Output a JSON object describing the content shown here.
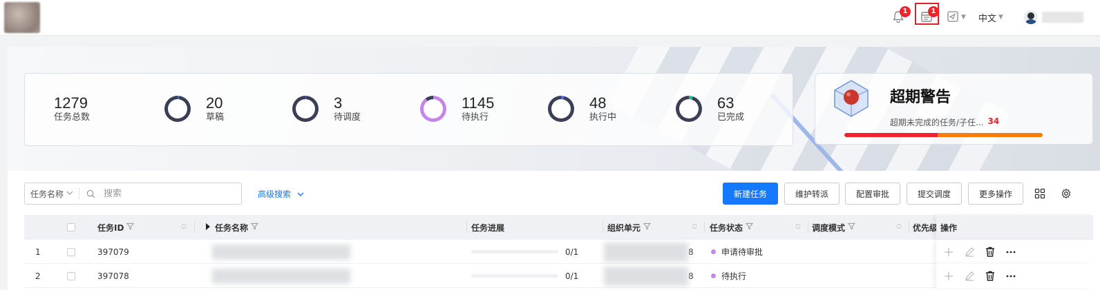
{
  "header": {
    "notification_count": "1",
    "todo_count": "1",
    "language": "中文"
  },
  "stats": [
    {
      "value": "1279",
      "label": "任务总数",
      "ring": false
    },
    {
      "value": "20",
      "label": "草稿",
      "ring": true,
      "fraction": 0.02,
      "color": "#4a6cf7"
    },
    {
      "value": "3",
      "label": "待调度",
      "ring": true,
      "fraction": 0.003,
      "color": "#4a6cf7"
    },
    {
      "value": "1145",
      "label": "待执行",
      "ring": true,
      "fraction": 0.9,
      "color": "#c586e8"
    },
    {
      "value": "48",
      "label": "执行中",
      "ring": true,
      "fraction": 0.04,
      "color": "#4a6cf7"
    },
    {
      "value": "63",
      "label": "已完成",
      "ring": true,
      "fraction": 0.05,
      "color": "#1fbf8f"
    }
  ],
  "warning": {
    "title": "超期警告",
    "text": "超期未完成的任务/子任...",
    "count": "34",
    "red_fraction": 0.47
  },
  "search": {
    "field_label": "任务名称",
    "placeholder": "搜索",
    "advanced_label": "高级搜索"
  },
  "toolbar": {
    "new_task": "新建任务",
    "transfer": "维护转派",
    "approval": "配置审批",
    "submit": "提交调度",
    "more": "更多操作"
  },
  "table": {
    "columns": {
      "id": "任务ID",
      "name": "任务名称",
      "progress": "任务进展",
      "org": "组织单元",
      "status": "任务状态",
      "mode": "调度模式",
      "priority": "优先级",
      "ops": "操作"
    },
    "rows": [
      {
        "index": "1",
        "id": "397079",
        "progress": "0/1",
        "org_suffix": "8",
        "status": "申请待审批",
        "status_color": "#c586e8"
      },
      {
        "index": "2",
        "id": "397078",
        "progress": "0/1",
        "org_suffix": "8",
        "status": "待执行",
        "status_color": "#c586e8"
      }
    ]
  },
  "colors": {
    "primary": "#1677ff",
    "danger": "#f5222d",
    "warning_orange": "#fa7d0a"
  }
}
